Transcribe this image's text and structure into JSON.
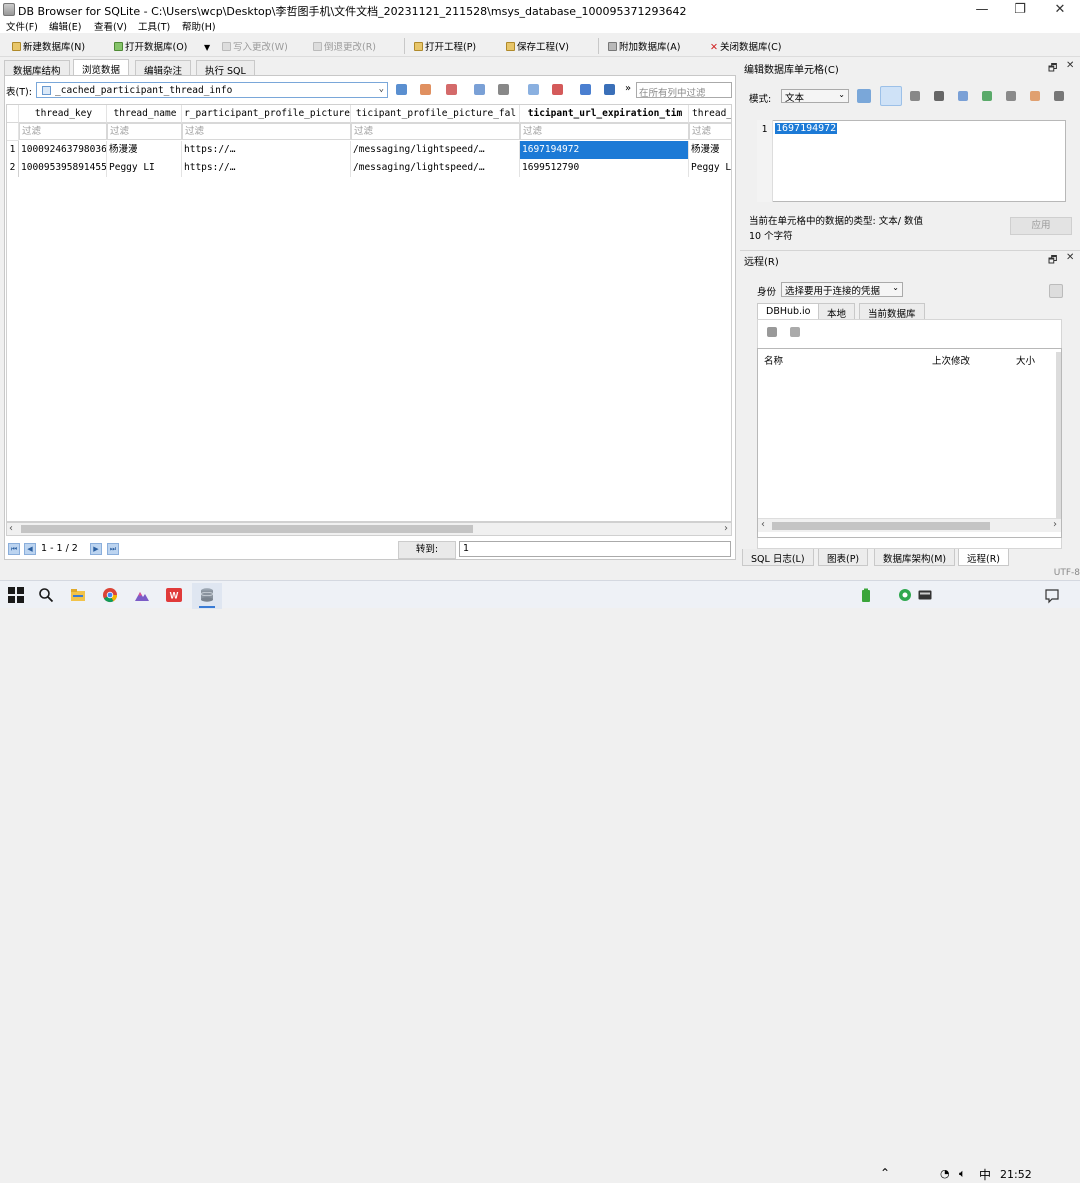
{
  "window": {
    "title": "DB Browser for SQLite - C:\\Users\\wcp\\Desktop\\李哲图手机\\文件文档_20231121_211528\\msys_database_100095371293642",
    "minimize": "—",
    "restore": "❐",
    "close": "✕"
  },
  "menu": [
    "文件(F)",
    "编辑(E)",
    "查看(V)",
    "工具(T)",
    "帮助(H)"
  ],
  "toolbar": {
    "new_db": "新建数据库(N)",
    "open_db": "打开数据库(O)",
    "write_changes": "写入更改(W)",
    "revert_changes": "倒退更改(R)",
    "open_project": "打开工程(P)",
    "save_project": "保存工程(V)",
    "attach_db": "附加数据库(A)",
    "close_db": "关闭数据库(C)"
  },
  "main_tabs": [
    "数据库结构",
    "浏览数据",
    "编辑杂注",
    "执行 SQL"
  ],
  "browse": {
    "table_label": "表(T):",
    "table_name": "_cached_participant_thread_info",
    "filter_all_placeholder": "在所有列中过滤",
    "filter_all_prefix": "»",
    "columns": [
      "thread_key",
      "thread_name",
      "r_participant_profile_picture",
      "ticipant_profile_picture_fal",
      "ticipant_url_expiration_tim",
      "thread_"
    ],
    "filter_placeholder": "过滤",
    "rows": [
      {
        "num": "1",
        "cells": [
          "100092463798036",
          "杨漫漫",
          "https://…",
          "/messaging/lightspeed/…",
          "1697194972",
          "杨漫漫"
        ]
      },
      {
        "num": "2",
        "cells": [
          "100095395891455",
          "Peggy LI",
          "https://…",
          "/messaging/lightspeed/…",
          "1699512790",
          "Peggy LI"
        ]
      }
    ],
    "pager": {
      "page_text": "1 - 1 / 2",
      "goto_label": "转到:",
      "goto_value": "1"
    }
  },
  "edit_cell": {
    "title": "编辑数据库单元格(C)",
    "mode_label": "模式:",
    "mode_value": "文本",
    "line_number": "1",
    "value": "1697194972",
    "type_info": "当前在单元格中的数据的类型: 文本/ 数值",
    "size_info": "10 个字符",
    "apply": "应用"
  },
  "remote": {
    "title": "远程(R)",
    "identity_label": "身份",
    "identity_value": "选择要用于连接的凭据",
    "tabs": [
      "DBHub.io",
      "本地",
      "当前数据库"
    ],
    "columns": [
      "名称",
      "上次修改",
      "大小"
    ]
  },
  "bottom_tabs": [
    "SQL 日志(L)",
    "图表(P)",
    "数据库架构(M)",
    "远程(R)"
  ],
  "status": {
    "encoding": "UTF-8"
  },
  "taskbar": {
    "ime": "中",
    "time": "21:52"
  },
  "colors": {
    "selection": "#1c7ad6",
    "taskbar": "#eef1f6"
  }
}
